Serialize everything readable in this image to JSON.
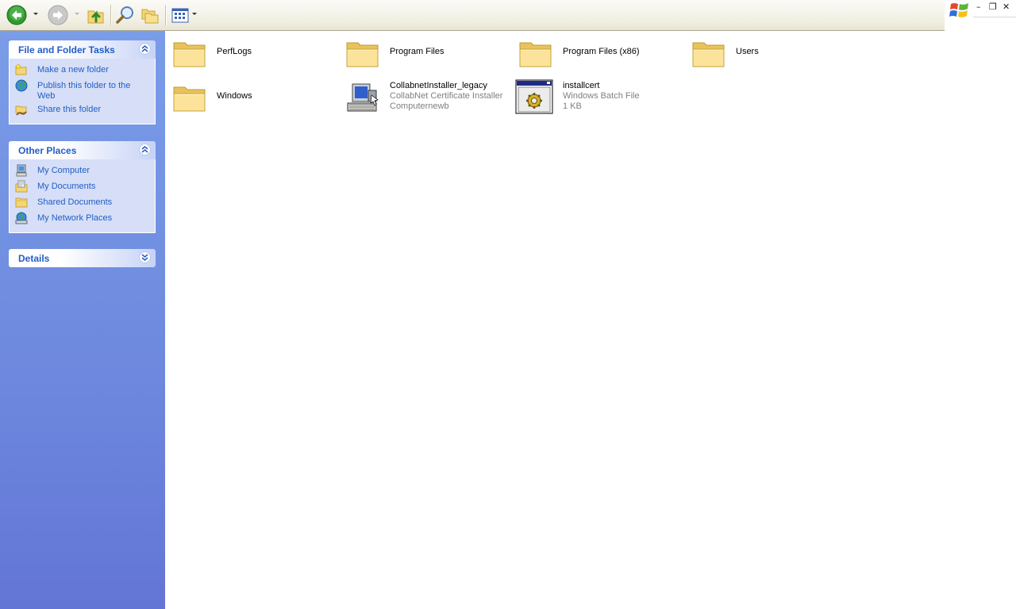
{
  "toolbar": {
    "buttons": [
      {
        "name": "back-button",
        "icon": "back-arrow-icon"
      },
      {
        "name": "forward-button",
        "icon": "forward-arrow-icon"
      },
      {
        "name": "up-button",
        "icon": "folder-up-icon"
      },
      {
        "name": "search-button",
        "icon": "search-icon"
      },
      {
        "name": "folders-button",
        "icon": "folders-icon"
      },
      {
        "name": "views-button",
        "icon": "views-icon"
      }
    ]
  },
  "window_controls": {
    "minimize": "–",
    "restore": "❐",
    "close": "✕"
  },
  "sidebar": {
    "file_tasks": {
      "title": "File and Folder Tasks",
      "items": [
        {
          "label": "Make a new folder",
          "icon": "new-folder-icon"
        },
        {
          "label": "Publish this folder to the Web",
          "icon": "globe-icon"
        },
        {
          "label": "Share this folder",
          "icon": "share-folder-icon"
        }
      ]
    },
    "other_places": {
      "title": "Other Places",
      "items": [
        {
          "label": "My Computer",
          "icon": "computer-icon"
        },
        {
          "label": "My Documents",
          "icon": "documents-icon"
        },
        {
          "label": "Shared Documents",
          "icon": "folder-icon"
        },
        {
          "label": "My Network Places",
          "icon": "network-icon"
        }
      ]
    },
    "details": {
      "title": "Details"
    }
  },
  "files": [
    {
      "name": "PerfLogs",
      "type": "folder"
    },
    {
      "name": "Program Files",
      "type": "folder"
    },
    {
      "name": "Program Files (x86)",
      "type": "folder"
    },
    {
      "name": "Users",
      "type": "folder"
    },
    {
      "name": "Windows",
      "type": "folder"
    },
    {
      "name": "CollabnetInstaller_legacy",
      "type": "installer",
      "description": "CollabNet Certificate Installer",
      "company": "Computernewb"
    },
    {
      "name": "installcert",
      "type": "batch",
      "description": "Windows Batch File",
      "size": "1 KB"
    }
  ],
  "colors": {
    "sidebar_link": "#215dc6",
    "sidebar_bg": "#6d88de",
    "panel_body": "#d6dff7",
    "subtext": "#808080"
  }
}
